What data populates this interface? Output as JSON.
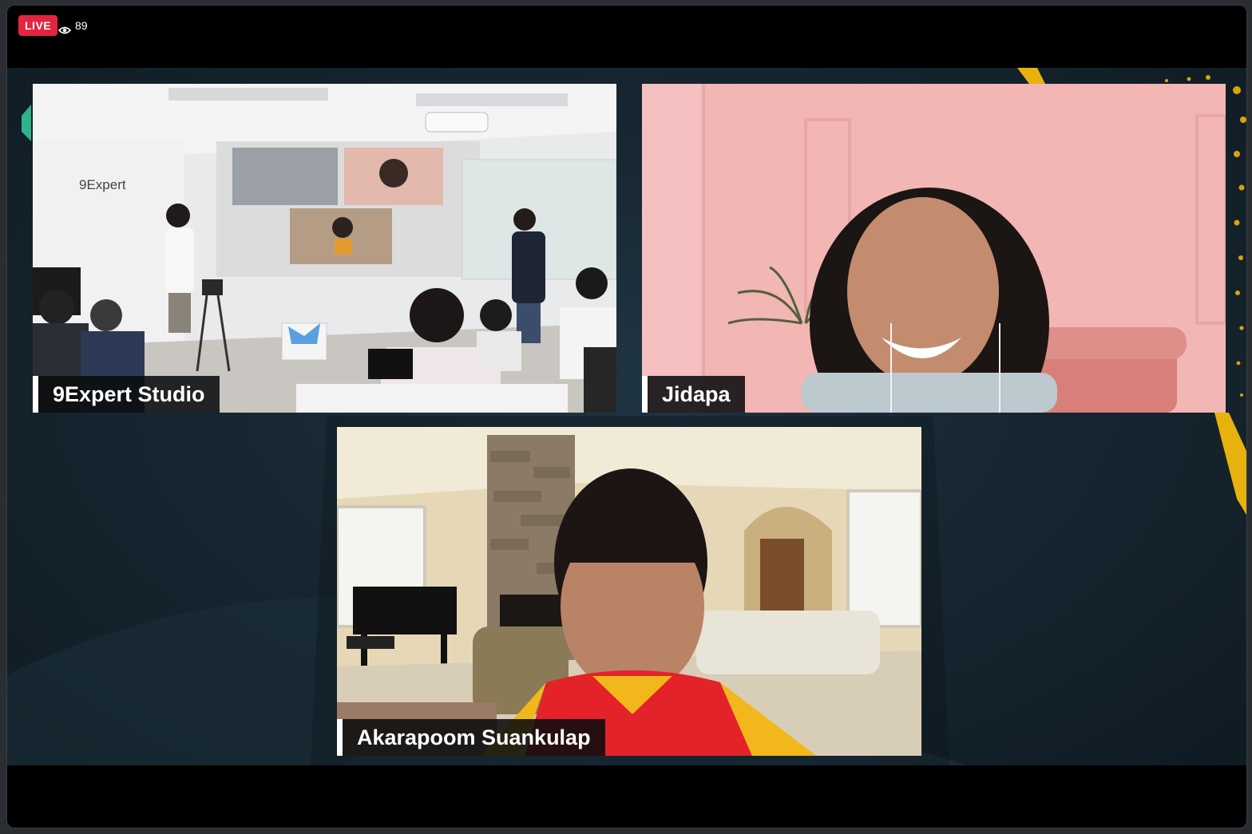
{
  "stream": {
    "live_label": "LIVE",
    "viewer_count": "89"
  },
  "icons": {
    "viewers": "eye-icon"
  },
  "colors": {
    "live_badge": "#e4253f",
    "accent_gold": "#f2b705",
    "stage_background": "#172732"
  },
  "participants": [
    {
      "name": "9Expert Studio"
    },
    {
      "name": "Jidapa"
    },
    {
      "name": "Akarapoom Suankulap"
    }
  ],
  "studio_scene": {
    "wall_logo": "9Expert"
  }
}
